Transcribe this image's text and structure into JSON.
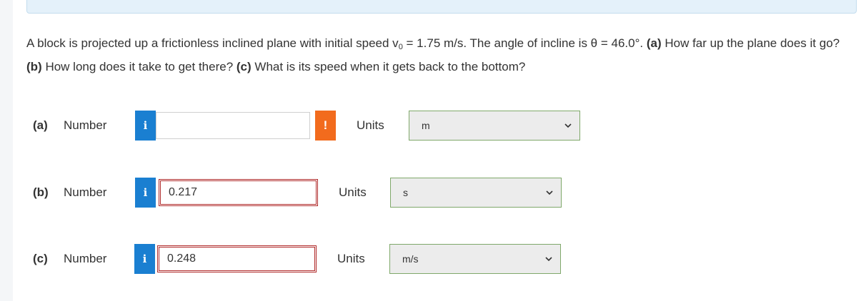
{
  "question": {
    "text_1": "A block is projected up a frictionless inclined plane with initial speed v",
    "sub": "0",
    "text_2": " = 1.75 m/s. The angle of incline is θ = 46.0°. ",
    "part_a_tag": "(a)",
    "text_3": " How far up the plane does it go? ",
    "part_b_tag": "(b)",
    "text_4": " How long does it take to get there? ",
    "part_c_tag": "(c)",
    "text_5": " What is its speed when it gets back to the bottom?"
  },
  "parts": [
    {
      "label": "(a)",
      "number_label": "Number",
      "info": "i",
      "value": "",
      "warning": "!",
      "units_label": "Units",
      "unit": "m"
    },
    {
      "label": "(b)",
      "number_label": "Number",
      "info": "i",
      "value": "0.217",
      "units_label": "Units",
      "unit": "s"
    },
    {
      "label": "(c)",
      "number_label": "Number",
      "info": "i",
      "value": "0.248",
      "units_label": "Units",
      "unit": "m/s"
    }
  ],
  "colors": {
    "info": "#1a7fd1",
    "warning": "#f26b1d",
    "incorrect_border": "#b02a2a"
  },
  "icons": {
    "info": "info-icon",
    "warning": "exclamation-icon",
    "dropdown": "chevron-down-icon"
  }
}
